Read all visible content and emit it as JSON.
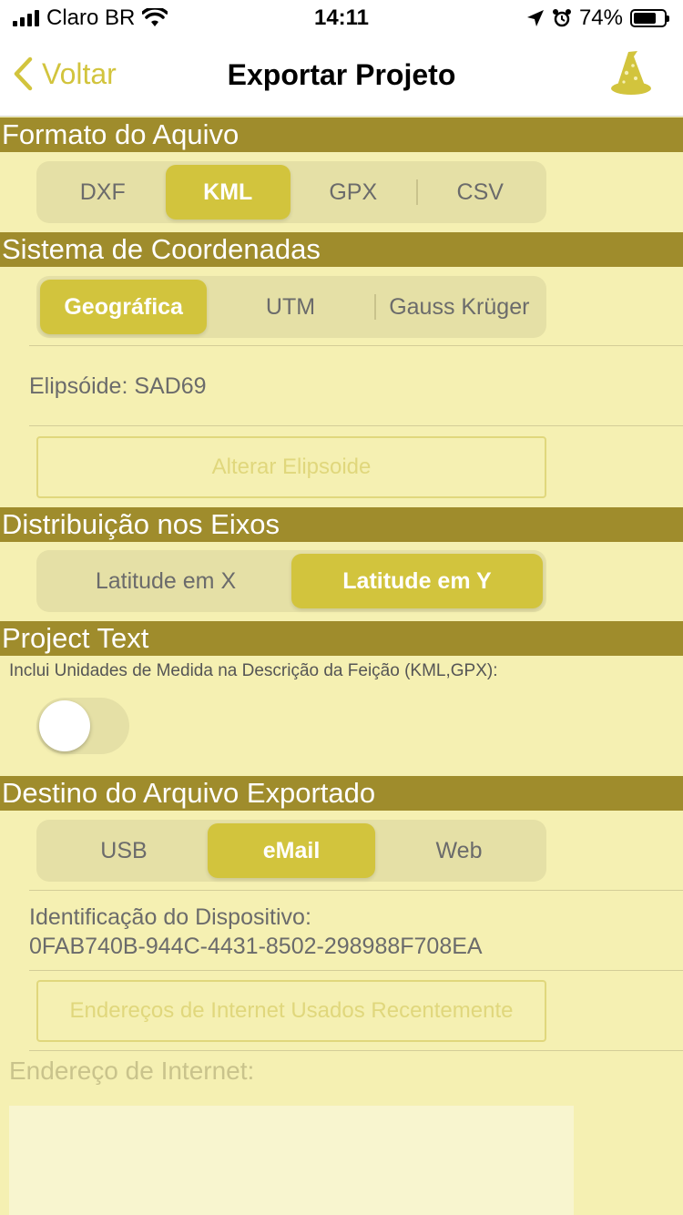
{
  "status_bar": {
    "carrier": "Claro BR",
    "time": "14:11",
    "battery_percent": "74%",
    "battery_level": 0.74
  },
  "nav": {
    "back_label": "Voltar",
    "title": "Exportar Projeto",
    "right_icon": "wizard-hat-icon"
  },
  "file_format": {
    "header": "Formato do Aquivo",
    "options": [
      "DXF",
      "KML",
      "GPX",
      "CSV"
    ],
    "selected": "KML"
  },
  "coordinates": {
    "header": "Sistema de Coordenadas",
    "options": [
      "Geográfica",
      "UTM",
      "Gauss Krüger"
    ],
    "selected": "Geográfica",
    "ellipsoid_text": "Elipsóide: SAD69",
    "change_button": "Alterar Elipsoide"
  },
  "axes": {
    "header": "Distribuição nos Eixos",
    "options": [
      "Latitude em X",
      "Latitude em Y"
    ],
    "selected": "Latitude em Y"
  },
  "project_text": {
    "header": "Project Text",
    "units_label": "Inclui Unidades de Medida na Descrição da Feição (KML,GPX):",
    "units_toggle_on": false
  },
  "destination": {
    "header": "Destino do Arquivo Exportado",
    "options": [
      "USB",
      "eMail",
      "Web"
    ],
    "selected": "eMail",
    "device_id_label": "Identificação do Dispositivo:",
    "device_id": "0FAB740B-944C-4431-8502-298988F708EA",
    "recent_urls_button": "Endereços de Internet Usados Recentemente",
    "url_label": "Endereço de Internet:",
    "url_value": ""
  },
  "colors": {
    "accent": "#d2c43d",
    "header_bg": "#9f8c2c",
    "page_bg": "#f5f0b2"
  }
}
